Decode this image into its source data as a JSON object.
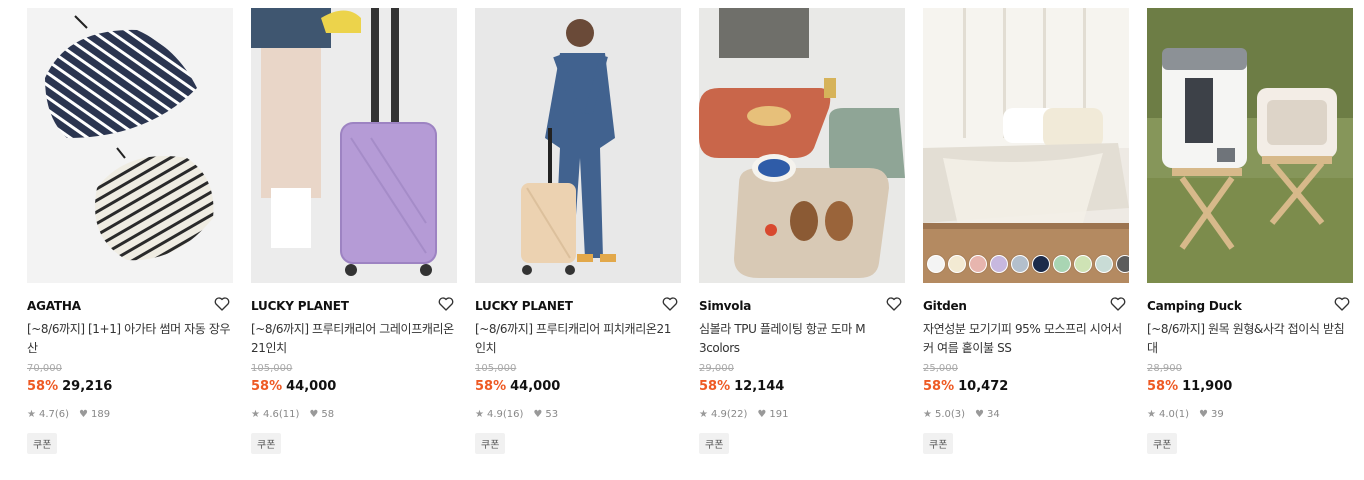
{
  "products": [
    {
      "brand": "AGATHA",
      "title": "[~8/6까지] [1+1] 아가타 썸머 자동 장우산",
      "original_price": "70,000",
      "discount": "58%",
      "price": "29,216",
      "rating": "4.7",
      "reviews": "(6)",
      "likes": "189",
      "coupon": "쿠폰",
      "image": "striped-umbrellas"
    },
    {
      "brand": "LUCKY PLANET",
      "title": "[~8/6까지] 프루티캐리어 그레이프캐리온21인치",
      "original_price": "105,000",
      "discount": "58%",
      "price": "44,000",
      "rating": "4.6",
      "reviews": "(11)",
      "likes": "58",
      "coupon": "쿠폰",
      "image": "purple-suitcase"
    },
    {
      "brand": "LUCKY PLANET",
      "title": "[~8/6까지] 프루티캐리어 피치캐리온21인치",
      "original_price": "105,000",
      "discount": "58%",
      "price": "44,000",
      "rating": "4.9",
      "reviews": "(16)",
      "likes": "53",
      "coupon": "쿠폰",
      "image": "peach-suitcase"
    },
    {
      "brand": "Simvola",
      "title": "심볼라 TPU 플레이팅 항균 도마 M 3colors",
      "original_price": "29,000",
      "discount": "58%",
      "price": "12,144",
      "rating": "4.9",
      "reviews": "(22)",
      "likes": "191",
      "coupon": "쿠폰",
      "image": "cutting-boards"
    },
    {
      "brand": "Gitden",
      "title": "자연성분 모기기피 95% 모스프리 시어서커 여름 홑이불 SS",
      "original_price": "25,000",
      "discount": "58%",
      "price": "10,472",
      "rating": "5.0",
      "reviews": "(3)",
      "likes": "34",
      "coupon": "쿠폰",
      "image": "bed-blanket",
      "swatch_colors": [
        "#f4f4f4",
        "#f3ead3",
        "#e7b5ae",
        "#c7b8df",
        "#b3bfcc",
        "#1c2b4a",
        "#a9d5b3",
        "#cfe3b5",
        "#c9dcd6",
        "#5c5c5c"
      ]
    },
    {
      "brand": "Camping Duck",
      "title": "[~8/6까지] 원목 원형&사각 접이식 받침대",
      "original_price": "28,900",
      "discount": "58%",
      "price": "11,900",
      "rating": "4.0",
      "reviews": "(1)",
      "likes": "39",
      "coupon": "쿠폰",
      "image": "water-jug-stands"
    }
  ]
}
